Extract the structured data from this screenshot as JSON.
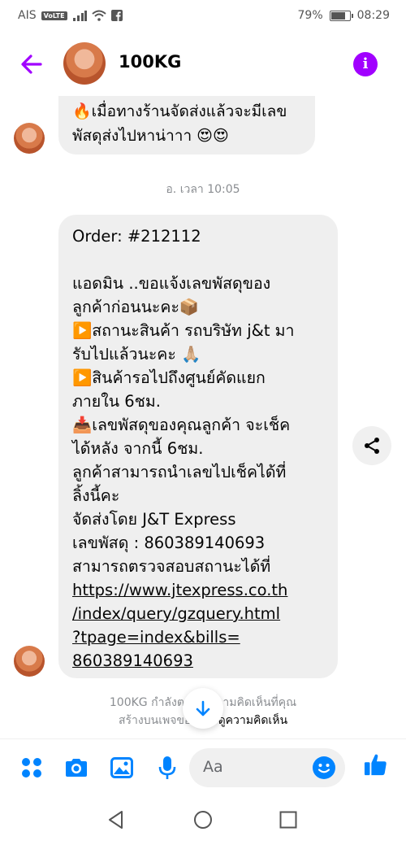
{
  "status_bar": {
    "carrier": "AIS",
    "volte": "VoLTE",
    "battery": "79%",
    "battery_level": 0.79,
    "time": "08:29"
  },
  "header": {
    "title": "100KG"
  },
  "messages": {
    "top_bubble": "🔥เมื่อทางร้านจัดส่งแล้วจะมีเลข\nพัสดุส่งไปหาน่าาา 😍😍",
    "timestamp": "อ. เวลา 10:05",
    "main_text": "Order: #212112\n\nแอดมิน ..ขอแจ้งเลขพัสดุของ\nลูกค้าก่อนนะคะ📦\n▶️สถานะสินค้า รถบริษัท j&t มา\nรับไปแล้วนะคะ 🙏🏼\n▶️สินค้ารอไปถึงศูนย์คัดแยก\nภายใน 6ชม.\n📥เลขพัสดุของคุณลูกค้า จะเช็ค\nได้หลัง จากนี้ 6ชม.\nลูกค้าสามารถนำเลขไปเช็คได้ที่\nลิ้งนี้คะ\nจัดส่งโดย J&T Express\nเลขพัสดุ : 860389140693\nสามารถตรวจสอบสถานะได้ที่",
    "link": "https://www.jtexpress.co.th\n/index/query/gzquery.html\n?tpage=index&bills=\n860389140693"
  },
  "notice": {
    "text": "100KG กำลังตอบก   ความคิดเห็นที่คุณ\nสร้างบนเพจของ   ขา",
    "link": "ดูความคิดเห็น"
  },
  "composer": {
    "placeholder": "Aa"
  },
  "colors": {
    "accent_purple": "#a100ff",
    "messenger_blue": "#0084ff",
    "bubble_gray": "#efefef"
  }
}
